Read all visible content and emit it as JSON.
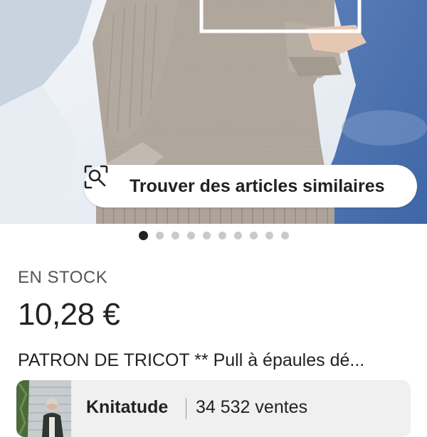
{
  "hero": {
    "similar_button_label": "Trouver des articles similaires",
    "similar_icon": "visual-search-icon"
  },
  "carousel": {
    "total_images": 10,
    "active_index": 0
  },
  "product": {
    "stock_label": "EN STOCK",
    "price": "10,28 €",
    "title": "PATRON DE TRICOT ** Pull à épaules dé..."
  },
  "shop": {
    "name": "Knitatude",
    "sales": "34 532 ventes"
  },
  "colors": {
    "text": "#222222",
    "muted": "#555555",
    "dot_inactive": "#c9c9c9",
    "dot_active": "#222222",
    "card_bg": "#f0f0f0"
  }
}
